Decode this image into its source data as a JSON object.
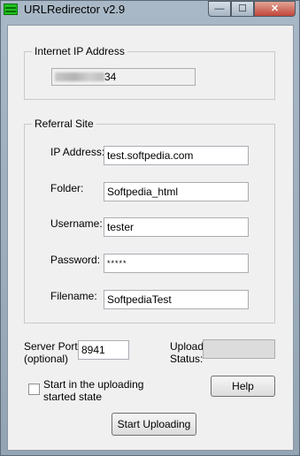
{
  "window": {
    "title": "URLRedirector v2.9",
    "minimize_glyph": "—",
    "maximize_glyph": "☐",
    "close_glyph": "✕"
  },
  "internet_ip": {
    "group_label": "Internet IP Address",
    "value_suffix": "34"
  },
  "referral": {
    "group_label": "Referral Site",
    "ip_label": "IP Address:",
    "ip_value": "test.softpedia.com",
    "folder_label": "Folder:",
    "folder_value": "Softpedia_html",
    "username_label": "Username:",
    "username_value": "tester",
    "password_label": "Password:",
    "password_value": "*****",
    "filename_label": "Filename:",
    "filename_value": "SoftpediaTest"
  },
  "server": {
    "port_label_line1": "Server Port:",
    "port_label_line2": "(optional)",
    "port_value": "8941"
  },
  "upload": {
    "status_label_line1": "Upload",
    "status_label_line2": "Status:",
    "status_value": ""
  },
  "options": {
    "start_state_line1": "Start in the uploading",
    "start_state_line2": "started state",
    "start_state_checked": false
  },
  "buttons": {
    "help": "Help",
    "start_uploading": "Start Uploading"
  },
  "colors": {
    "app_icon": "#1fc21f",
    "close_button": "#c2453a"
  }
}
